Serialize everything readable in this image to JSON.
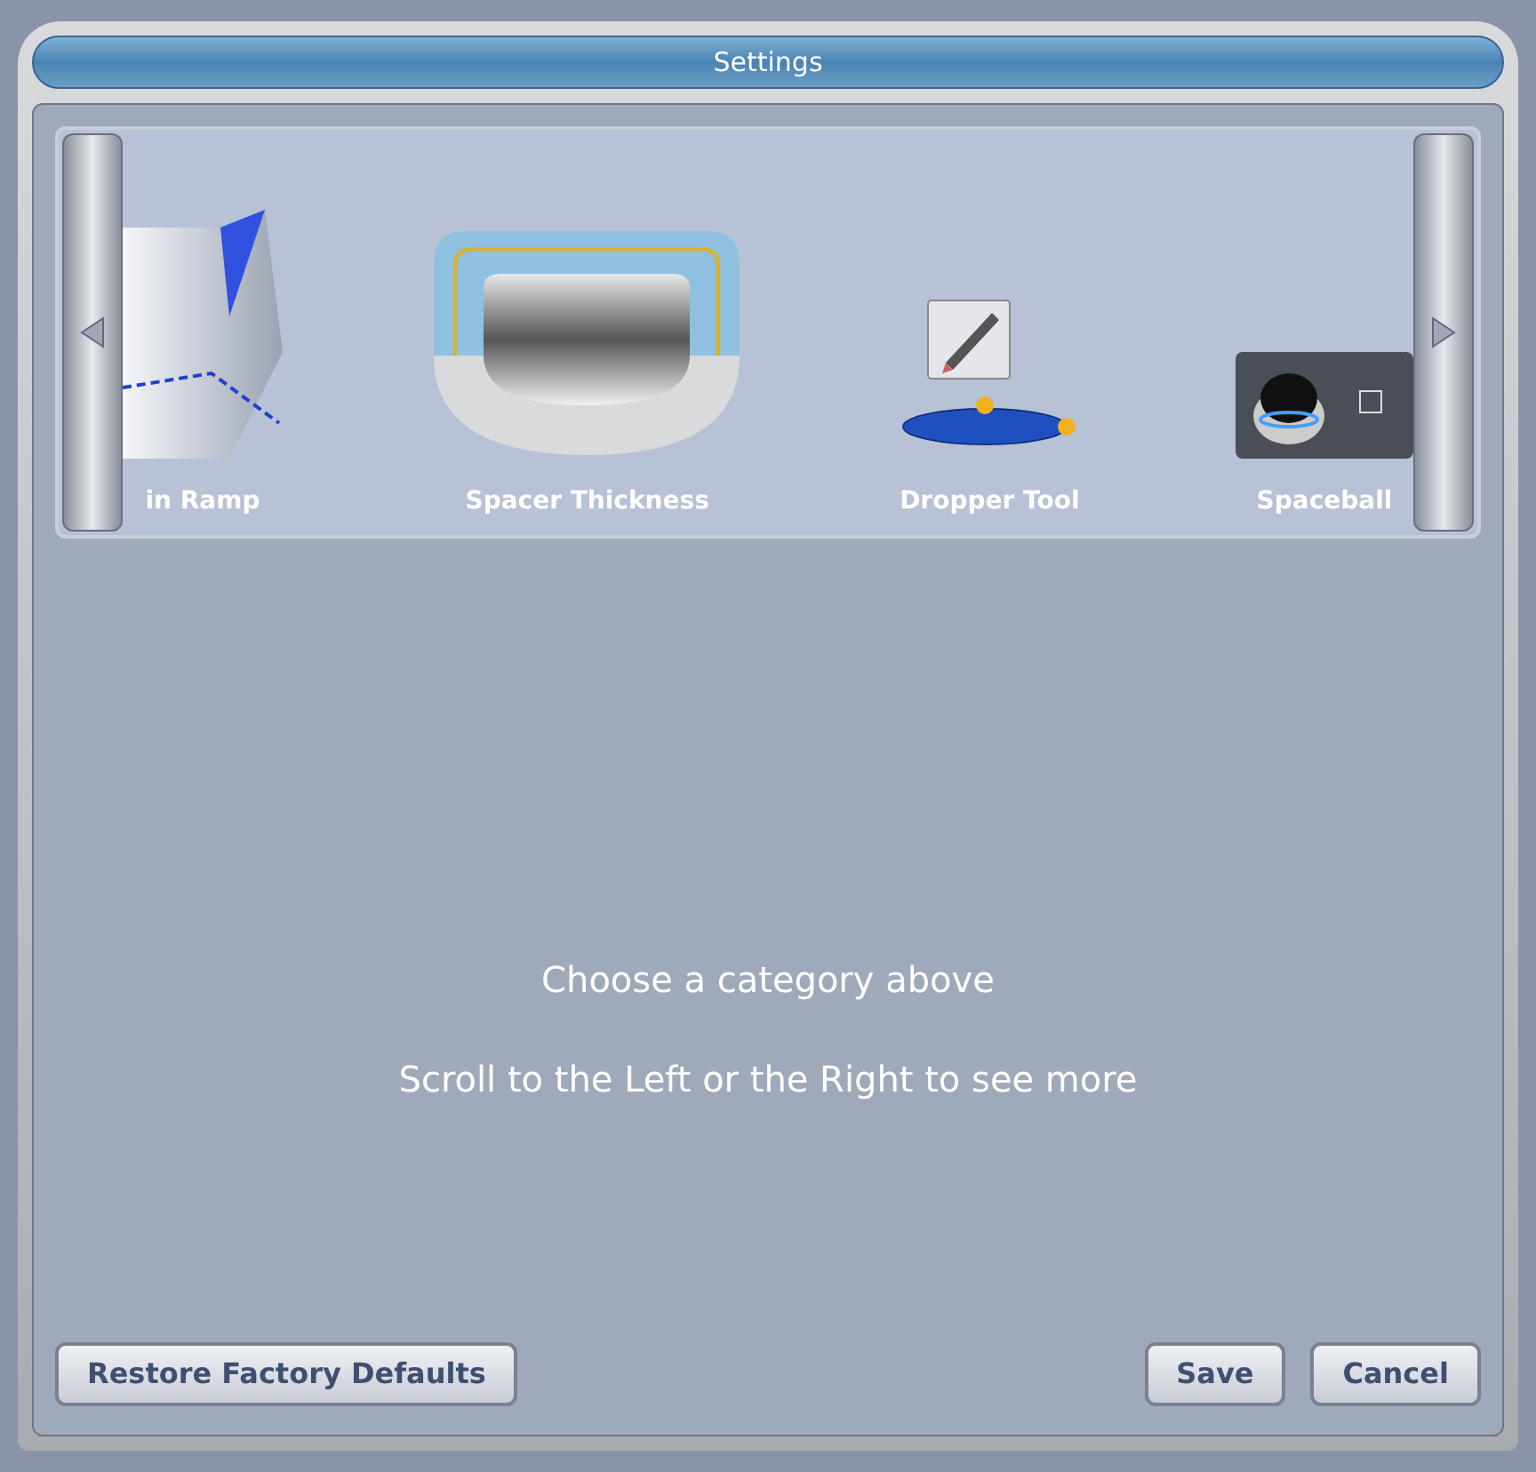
{
  "window": {
    "title": "Settings"
  },
  "carousel": {
    "items": [
      {
        "kind": "ramp",
        "label": "in Ramp"
      },
      {
        "kind": "spacer",
        "label": "Spacer Thickness"
      },
      {
        "kind": "dropper",
        "label": "Dropper Tool"
      },
      {
        "kind": "spaceball",
        "label": "Spaceball"
      }
    ]
  },
  "messages": [
    "Choose a category above",
    "Scroll to the Left or the Right to see more"
  ],
  "buttons": {
    "left": [
      "Restore Factory Defaults"
    ],
    "right": [
      "Save",
      "Cancel"
    ]
  }
}
